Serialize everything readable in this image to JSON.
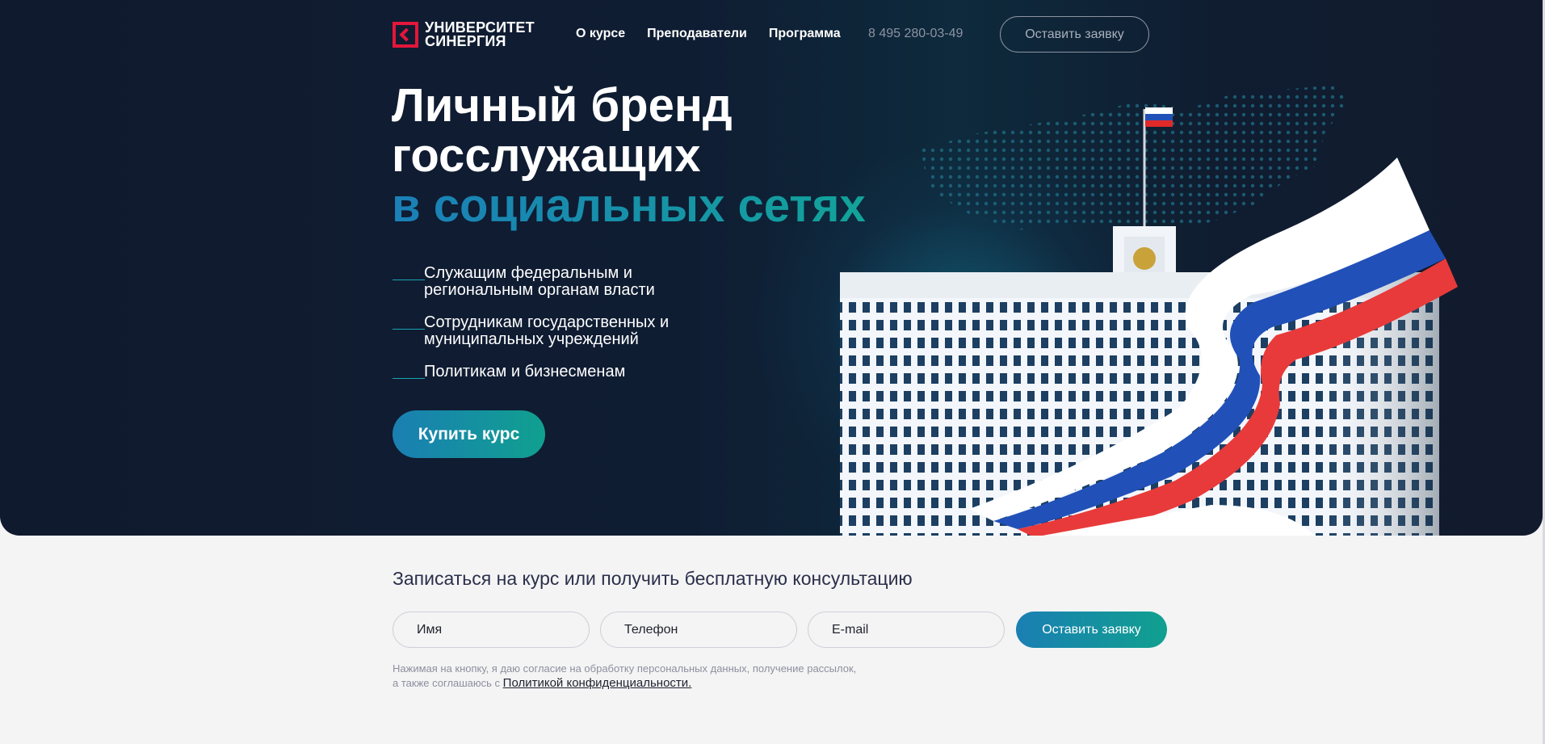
{
  "header": {
    "logo_line1": "УНИВЕРСИТЕТ",
    "logo_line2": "СИНЕРГИЯ",
    "nav": [
      "О курсе",
      "Преподаватели",
      "Программа"
    ],
    "phone": "8 495 280-03-49",
    "cta": "Оставить заявку"
  },
  "hero": {
    "title_line1": "Личный бренд",
    "title_line2": "госслужащих",
    "title_line3": "в социальных сетях",
    "bullets": [
      {
        "line1": "Служащим федеральным и",
        "line2": "региональным органам власти"
      },
      {
        "line1": "Сотрудникам государственных и",
        "line2": "муниципальных учреждений"
      },
      {
        "line1": "Политикам и бизнесменам",
        "line2": ""
      }
    ],
    "buy_button": "Купить курс"
  },
  "form": {
    "title": "Записаться на курс или получить бесплатную консультацию",
    "name_placeholder": "Имя",
    "phone_placeholder": "Телефон",
    "email_placeholder": "E-mail",
    "submit": "Оставить заявку",
    "consent_line1": "Нажимая на кнопку, я даю согласие на обработку персональных данных, получение рассылок,",
    "consent_line2": "а также соглашаюсь с",
    "policy_link": "Политикой конфиденциальности."
  },
  "colors": {
    "brand_red": "#e3163b",
    "accent_blue": "#1a7fb3",
    "accent_teal": "#10a08f",
    "hero_bg": "#101a2e"
  }
}
